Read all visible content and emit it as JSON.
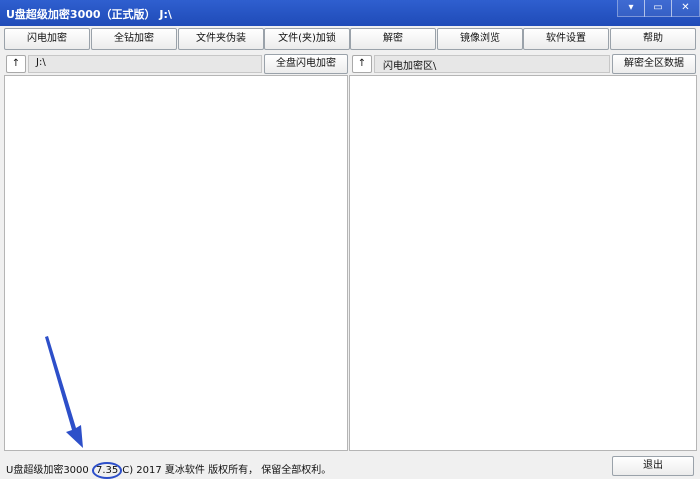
{
  "window": {
    "title": "U盘超级加密3000（正式版） J:\\",
    "controls": [
      "minimize-icon",
      "maximize-icon",
      "close-icon"
    ]
  },
  "toolbar": {
    "buttons": [
      "闪电加密",
      "全钻加密",
      "文件夹伪装",
      "文件(夹)加锁",
      "解密",
      "镜像浏览",
      "软件设置",
      "帮助"
    ]
  },
  "left_panel": {
    "up_label": "↑",
    "path": "J:\\",
    "action_label": "全盘闪电加密"
  },
  "right_panel": {
    "up_label": "↑",
    "path": "闪电加密区\\",
    "action_label": "解密全区数据"
  },
  "status": {
    "prefix": "U盘超级加密3000",
    "version": "7.35",
    "suffix": "C) 2017 夏冰软件 版权所有， 保留全部权利。"
  },
  "footer": {
    "exit_label": "退出"
  },
  "colors": {
    "titlebar": "#2f5fcf",
    "annotation": "#2d4fc9"
  }
}
